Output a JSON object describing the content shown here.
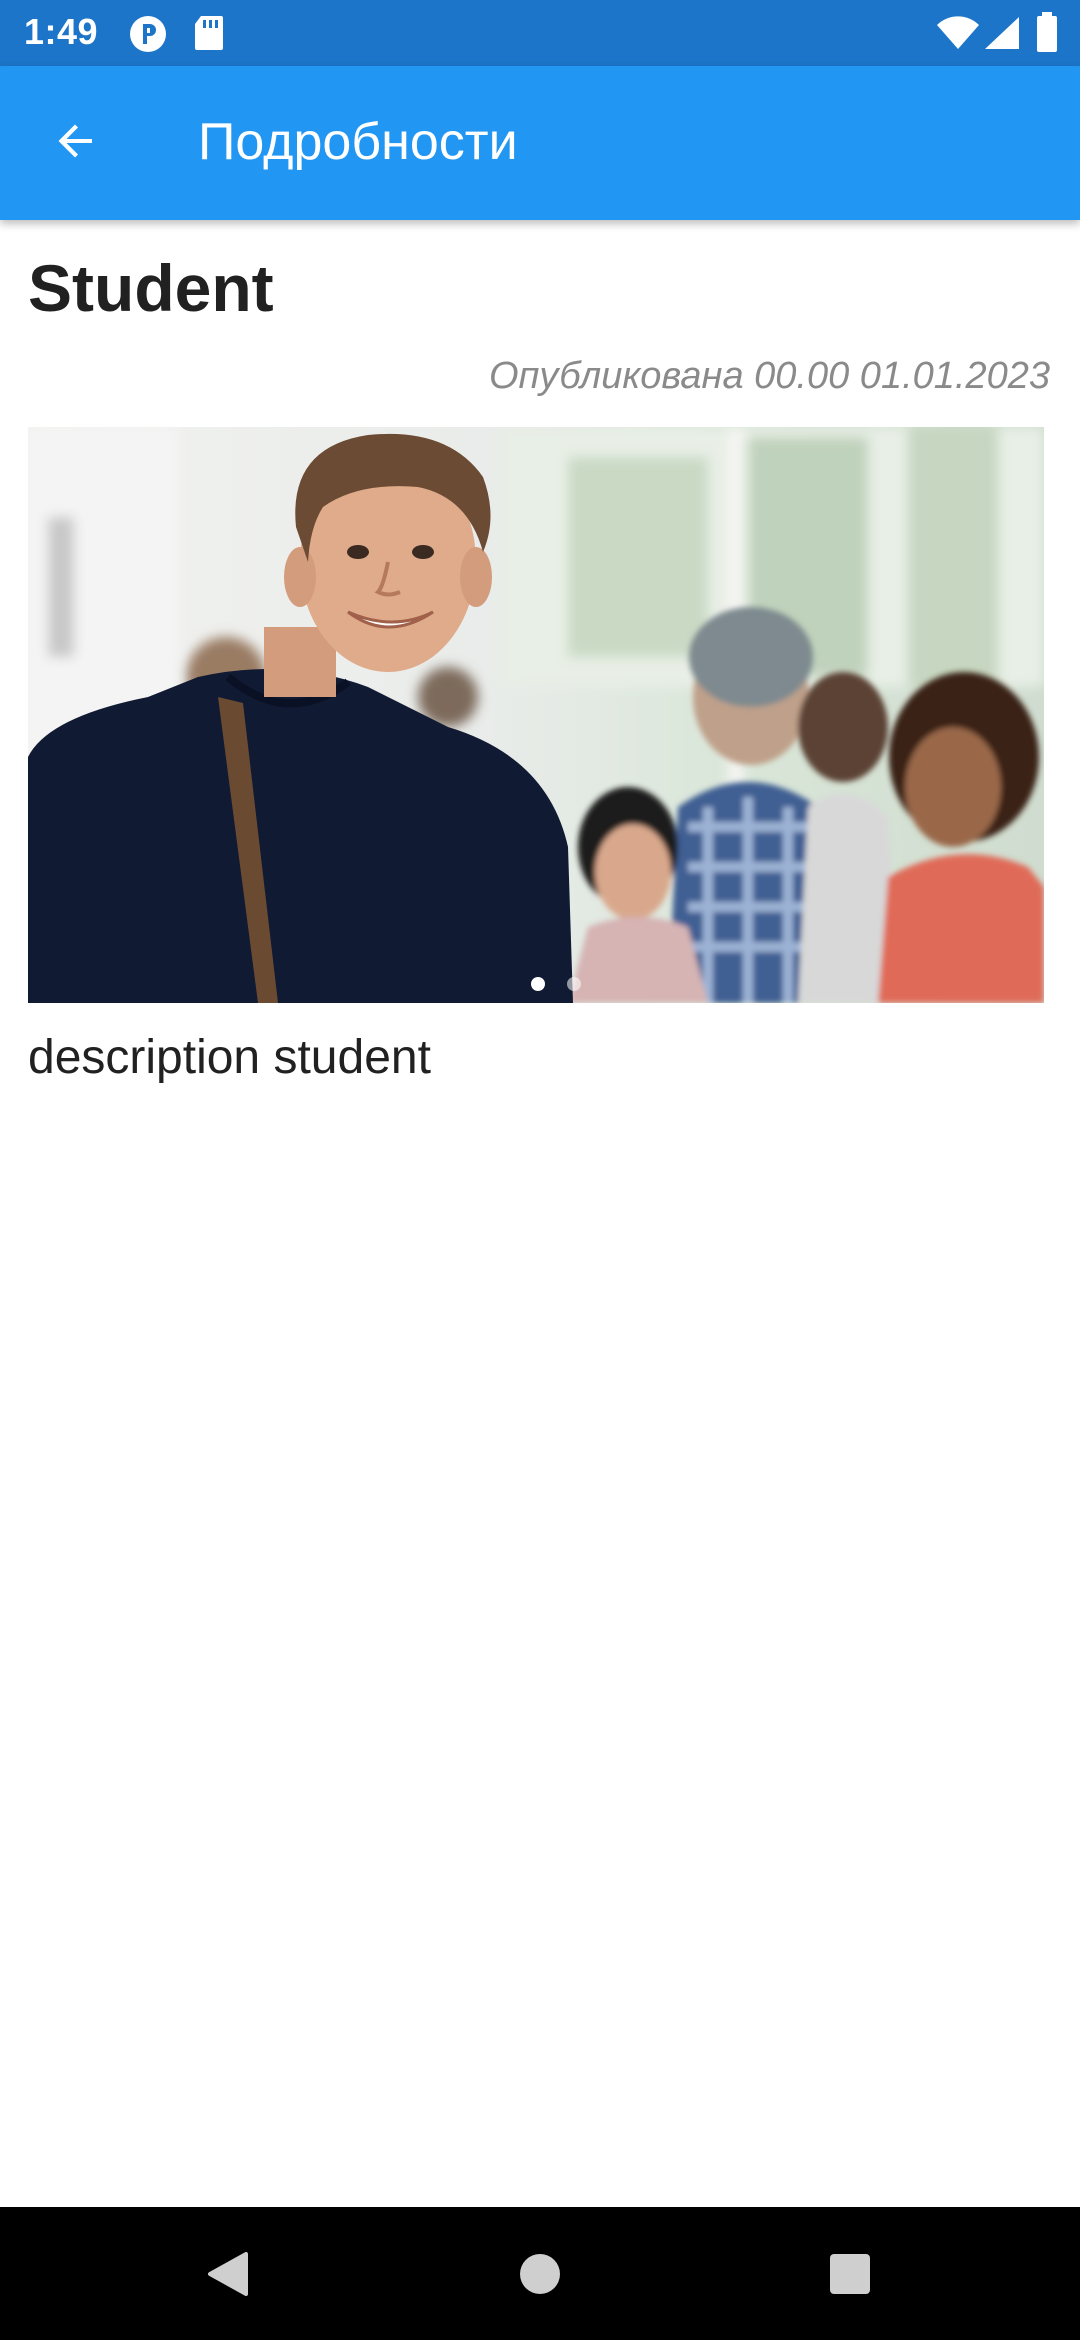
{
  "status_bar": {
    "time": "1:49",
    "icons": [
      "location-p-icon",
      "sd-card-icon",
      "wifi-icon",
      "signal-icon",
      "battery-icon"
    ]
  },
  "app_bar": {
    "back_icon": "arrow-back-icon",
    "title": "Подробности",
    "color": "#2196f3"
  },
  "post": {
    "title": "Student",
    "published": "Опубликована 00.00 01.01.2023",
    "carousel": {
      "image": "student-photo",
      "pages": 2,
      "current_page": 1
    },
    "description": "description student"
  },
  "nav_bar": {
    "icons": [
      "back-triangle-icon",
      "home-circle-icon",
      "recents-square-icon"
    ]
  }
}
